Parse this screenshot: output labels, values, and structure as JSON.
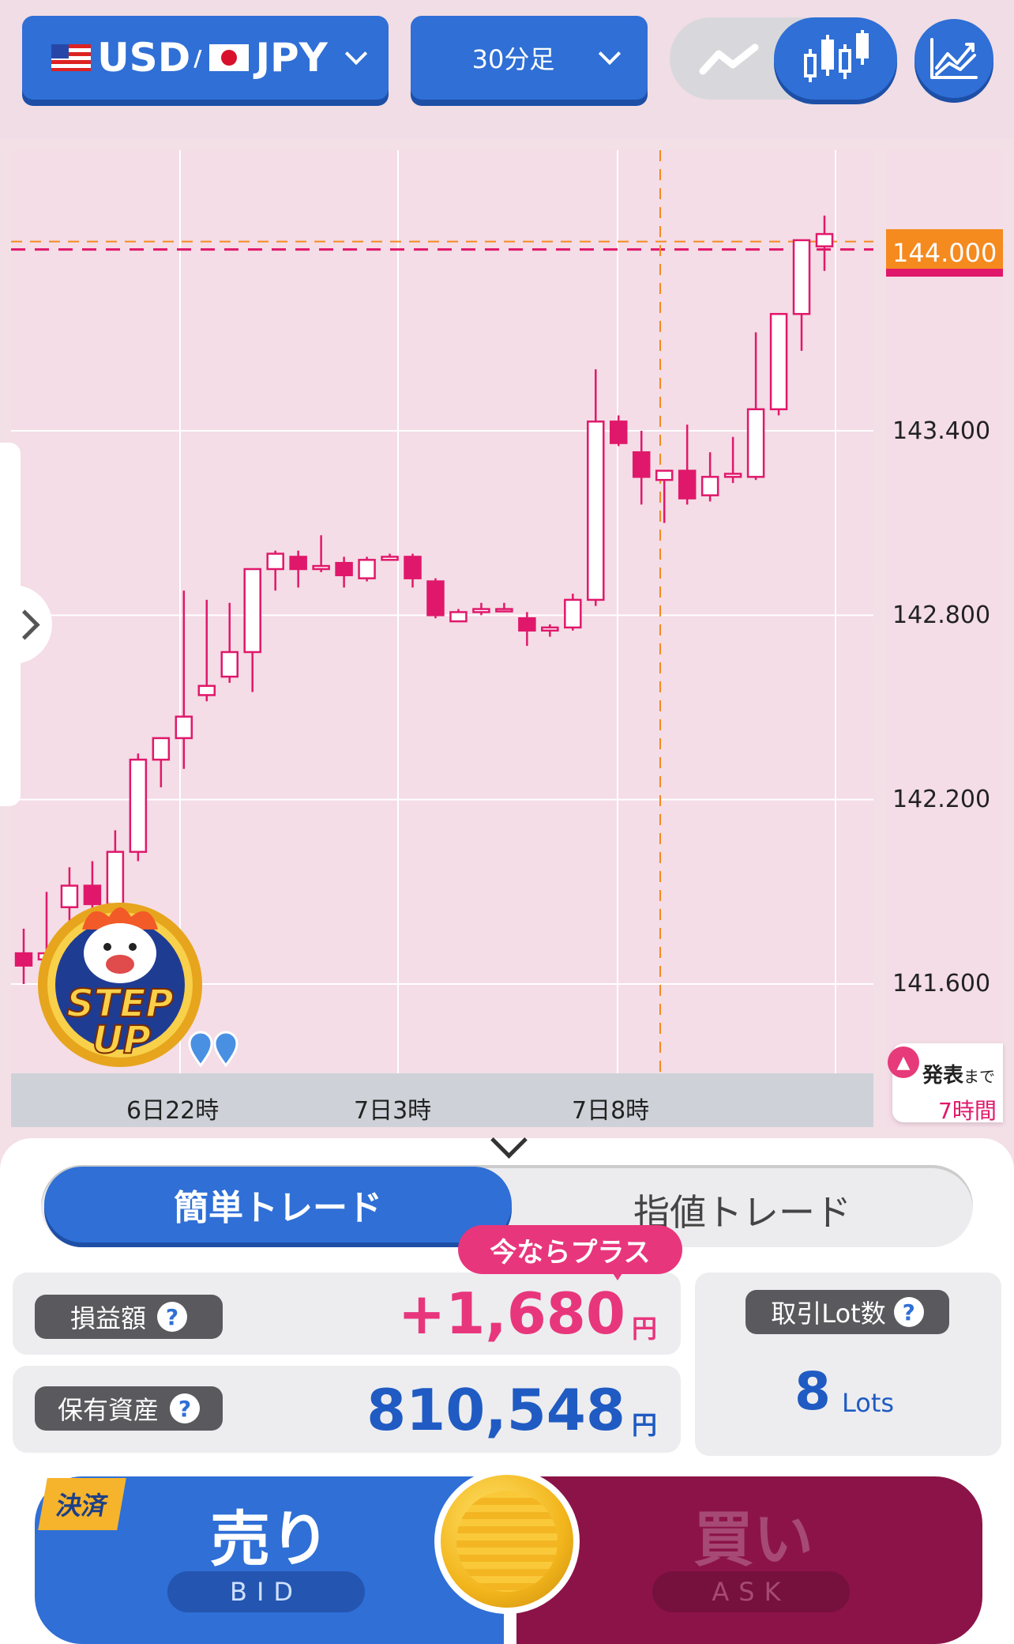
{
  "header": {
    "pair_base": "USD",
    "pair_separator": "/",
    "pair_quote": "JPY",
    "timeframe": "30分足"
  },
  "chart": {
    "current_price": "144.000",
    "y_labels": [
      "143.400",
      "142.800",
      "142.200",
      "141.600"
    ],
    "x_labels": [
      "6日22時",
      "7日3時",
      "7日8時"
    ],
    "announcement_label": "発表",
    "announcement_suffix": "まで",
    "announcement_time": "7時間",
    "badge_line1": "STEP",
    "badge_line2": "UP"
  },
  "chart_data": {
    "type": "candlestick",
    "yticks": [
      143.4,
      142.8,
      142.2,
      141.6
    ],
    "xticks": [
      "6日22時",
      "7日3時",
      "7日8時"
    ],
    "last_price": 144.0,
    "candles": [
      {
        "o": 141.7,
        "h": 141.78,
        "l": 141.6,
        "c": 141.66
      },
      {
        "o": 141.68,
        "h": 141.9,
        "l": 141.62,
        "c": 141.7
      },
      {
        "o": 141.85,
        "h": 141.98,
        "l": 141.7,
        "c": 141.92
      },
      {
        "o": 141.92,
        "h": 142.0,
        "l": 141.8,
        "c": 141.86
      },
      {
        "o": 141.86,
        "h": 142.1,
        "l": 141.84,
        "c": 142.03
      },
      {
        "o": 142.03,
        "h": 142.35,
        "l": 142.0,
        "c": 142.33
      },
      {
        "o": 142.33,
        "h": 142.4,
        "l": 142.24,
        "c": 142.4
      },
      {
        "o": 142.4,
        "h": 142.88,
        "l": 142.3,
        "c": 142.47
      },
      {
        "o": 142.54,
        "h": 142.85,
        "l": 142.52,
        "c": 142.57
      },
      {
        "o": 142.6,
        "h": 142.84,
        "l": 142.58,
        "c": 142.68
      },
      {
        "o": 142.68,
        "h": 142.93,
        "l": 142.55,
        "c": 142.95
      },
      {
        "o": 142.95,
        "h": 143.01,
        "l": 142.88,
        "c": 143.0
      },
      {
        "o": 142.99,
        "h": 143.01,
        "l": 142.89,
        "c": 142.95
      },
      {
        "o": 142.95,
        "h": 143.06,
        "l": 142.94,
        "c": 142.96
      },
      {
        "o": 142.97,
        "h": 142.99,
        "l": 142.89,
        "c": 142.93
      },
      {
        "o": 142.92,
        "h": 142.99,
        "l": 142.91,
        "c": 142.98
      },
      {
        "o": 142.98,
        "h": 143.0,
        "l": 142.98,
        "c": 142.99
      },
      {
        "o": 142.99,
        "h": 143.0,
        "l": 142.89,
        "c": 142.92
      },
      {
        "o": 142.91,
        "h": 142.92,
        "l": 142.79,
        "c": 142.8
      },
      {
        "o": 142.78,
        "h": 142.82,
        "l": 142.78,
        "c": 142.81
      },
      {
        "o": 142.81,
        "h": 142.84,
        "l": 142.8,
        "c": 142.82
      },
      {
        "o": 142.82,
        "h": 142.84,
        "l": 142.81,
        "c": 142.82
      },
      {
        "o": 142.79,
        "h": 142.81,
        "l": 142.7,
        "c": 142.75
      },
      {
        "o": 142.75,
        "h": 142.77,
        "l": 142.73,
        "c": 142.76
      },
      {
        "o": 142.76,
        "h": 142.87,
        "l": 142.75,
        "c": 142.85
      },
      {
        "o": 142.85,
        "h": 143.6,
        "l": 142.83,
        "c": 143.43
      },
      {
        "o": 143.43,
        "h": 143.45,
        "l": 143.35,
        "c": 143.36
      },
      {
        "o": 143.33,
        "h": 143.4,
        "l": 143.16,
        "c": 143.25
      },
      {
        "o": 143.24,
        "h": 143.27,
        "l": 143.1,
        "c": 143.27
      },
      {
        "o": 143.27,
        "h": 143.42,
        "l": 143.16,
        "c": 143.18
      },
      {
        "o": 143.19,
        "h": 143.33,
        "l": 143.17,
        "c": 143.25
      },
      {
        "o": 143.25,
        "h": 143.38,
        "l": 143.23,
        "c": 143.26
      },
      {
        "o": 143.25,
        "h": 143.72,
        "l": 143.24,
        "c": 143.47
      },
      {
        "o": 143.47,
        "h": 143.77,
        "l": 143.45,
        "c": 143.78
      },
      {
        "o": 143.78,
        "h": 144.0,
        "l": 143.66,
        "c": 144.02
      },
      {
        "o": 144.0,
        "h": 144.1,
        "l": 143.92,
        "c": 144.04
      }
    ]
  },
  "trade": {
    "tab_simple": "簡単トレード",
    "tab_limit": "指値トレード",
    "promo": "今ならプラス",
    "pl_label": "損益額",
    "pl_value": "+1,680",
    "pl_unit": "円",
    "assets_label": "保有資産",
    "assets_value": "810,548",
    "assets_unit": "円",
    "lots_label": "取引Lot数",
    "lots_value": "8",
    "lots_unit": "Lots",
    "help": "?",
    "settle_badge": "決済",
    "sell_label": "売り",
    "sell_sub": "BID",
    "buy_label": "買い",
    "buy_sub": "ASK"
  },
  "colors": {
    "accent_blue": "#2f6fd6",
    "candle_pink": "#e0186b",
    "profit_pink": "#e8367c",
    "buy_dark": "#8c1348",
    "price_tag_orange": "#f58a1f"
  }
}
